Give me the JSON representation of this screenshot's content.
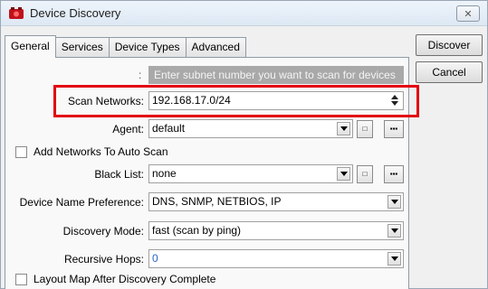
{
  "window": {
    "title": "Device Discovery",
    "close_glyph": "✕",
    "icon": "device-icon",
    "accent_color": "#e30613"
  },
  "tabs": [
    {
      "label": "General",
      "active": true
    },
    {
      "label": "Services",
      "active": false
    },
    {
      "label": "Device Types",
      "active": false
    },
    {
      "label": "Advanced",
      "active": false
    }
  ],
  "buttons": {
    "discover": "Discover",
    "cancel": "Cancel"
  },
  "form": {
    "subnet_hint": "Enter subnet number you want to scan for devices",
    "subnet_colon": ":",
    "scan_networks_label": "Scan Networks:",
    "scan_networks_value": "192.168.17.0/24",
    "agent_label": "Agent:",
    "agent_value": "default",
    "add_networks_label": "Add Networks To Auto Scan",
    "black_list_label": "Black List:",
    "black_list_value": "none",
    "name_pref_label": "Device Name Preference:",
    "name_pref_value": "DNS, SNMP, NETBIOS, IP",
    "discovery_mode_label": "Discovery Mode:",
    "discovery_mode_value": "fast (scan by ping)",
    "recursive_hops_label": "Recursive Hops:",
    "recursive_hops_value": "0",
    "layout_map_label": "Layout Map After Discovery Complete",
    "small_btn_glyph": "□",
    "dots_btn_glyph": "▪▪▪"
  }
}
